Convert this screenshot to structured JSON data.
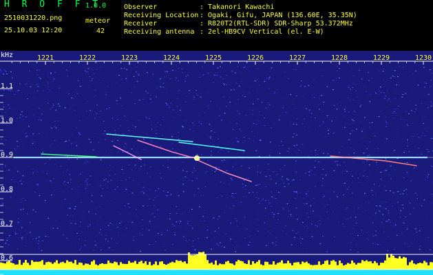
{
  "header": {
    "app_title": "H R O F F T",
    "app_version": "1.0.0",
    "filename": "2510031220.png",
    "mode_label": "meteor",
    "datetime": "25.10.03 12:20",
    "count": "42"
  },
  "info": [
    {
      "label": "Observer",
      "value": ": Takanori Kawachi"
    },
    {
      "label": "Receiving Location",
      "value": ": Ogaki, Gifu, JAPAN (136.60E, 35.35N)"
    },
    {
      "label": "Receiver",
      "value": ": R820T2(RTL-SDR) SDR-Sharp 53.372MHz"
    },
    {
      "label": "Receiving antenna",
      "value": ": 2el-HB9CV Vertical (el. E-W)"
    }
  ],
  "spectrogram": {
    "y_unit": "kHz",
    "y_ticks": [
      "1.1",
      "1.0",
      "0.9",
      "0.8",
      "0.7",
      "0.6"
    ],
    "time_ticks": [
      "1221",
      "1222",
      "1223",
      "1224",
      "1225",
      "1226",
      "1227",
      "1228",
      "1229",
      "1230"
    ],
    "carrier_khz": 0.9,
    "colors": {
      "label": "#ffffff",
      "tick": "#ffff30",
      "header": "#00ff40",
      "grid": "#ffffff",
      "bg": "#1a1a80"
    }
  }
}
